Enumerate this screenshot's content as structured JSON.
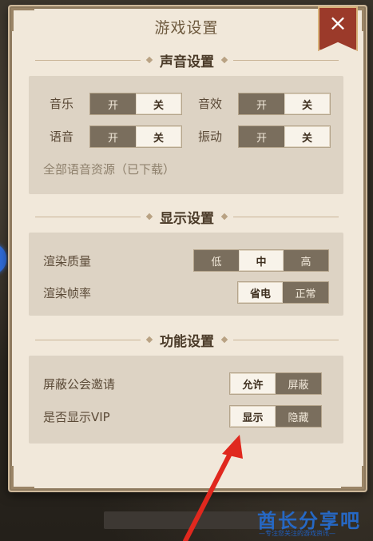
{
  "dialog": {
    "title": "游戏设置",
    "close_icon": "×"
  },
  "sound": {
    "heading": "声音设置",
    "music": {
      "label": "音乐",
      "on": "开",
      "off": "关",
      "selected": "off"
    },
    "sfx": {
      "label": "音效",
      "on": "开",
      "off": "关",
      "selected": "off"
    },
    "voice": {
      "label": "语音",
      "on": "开",
      "off": "关",
      "selected": "off"
    },
    "vibration": {
      "label": "振动",
      "on": "开",
      "off": "关",
      "selected": "off"
    },
    "voice_resources": "全部语音资源（已下载）"
  },
  "display": {
    "heading": "显示设置",
    "quality": {
      "label": "渲染质量",
      "options": [
        "低",
        "中",
        "高"
      ],
      "selected": "中"
    },
    "framerate": {
      "label": "渲染帧率",
      "options": [
        "省电",
        "正常"
      ],
      "selected": "省电"
    }
  },
  "function": {
    "heading": "功能设置",
    "guild_invite": {
      "label": "屏蔽公会邀请",
      "options": [
        "允许",
        "屏蔽"
      ],
      "selected": "允许"
    },
    "show_vip": {
      "label": "是否显示VIP",
      "options": [
        "显示",
        "隐藏"
      ],
      "selected": "显示"
    }
  },
  "watermark": {
    "brand": "酋长分享吧",
    "slogan": "—专注您关注的游戏资讯—"
  },
  "colors": {
    "panel": "#f1e8da",
    "group": "#ddd3c4",
    "toggle_off": "#7a6e5d",
    "toggle_on": "#f8f3ea",
    "close": "#9b3a2a",
    "arrow": "#e0281e"
  }
}
